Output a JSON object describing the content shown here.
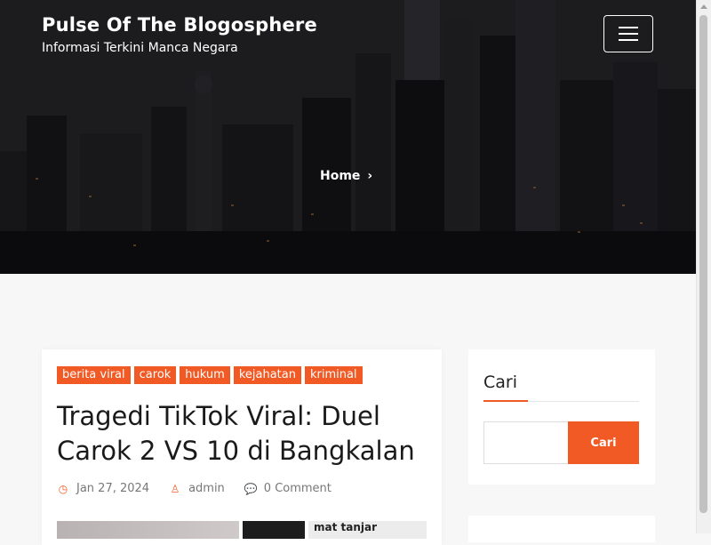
{
  "header": {
    "site_title": "Pulse Of The Blogosphere",
    "tagline": "Informasi Terkini Manca Negara",
    "menu_icon": "hamburger-menu-icon"
  },
  "breadcrumb": {
    "items": [
      "Home"
    ],
    "separator_icon": "chevron-right-icon"
  },
  "post": {
    "tags": [
      "berita viral",
      "carok",
      "hukum",
      "kejahatan",
      "kriminal"
    ],
    "title": "Tragedi TikTok Viral: Duel Carok 2 VS 10 di Bangkalan",
    "date": "Jan 27, 2024",
    "author": "admin",
    "comments": "0 Comment",
    "thumbnail_text": "mat tanjar",
    "date_icon": "clock-icon",
    "author_icon": "user-icon",
    "comments_icon": "comments-icon"
  },
  "sidebar": {
    "search_widget": {
      "title": "Cari",
      "input_value": "",
      "button_label": "Cari"
    }
  },
  "colors": {
    "accent": "#f15a24",
    "hero_bg": "#1c1c20",
    "page_bg": "#f7f7f7"
  }
}
